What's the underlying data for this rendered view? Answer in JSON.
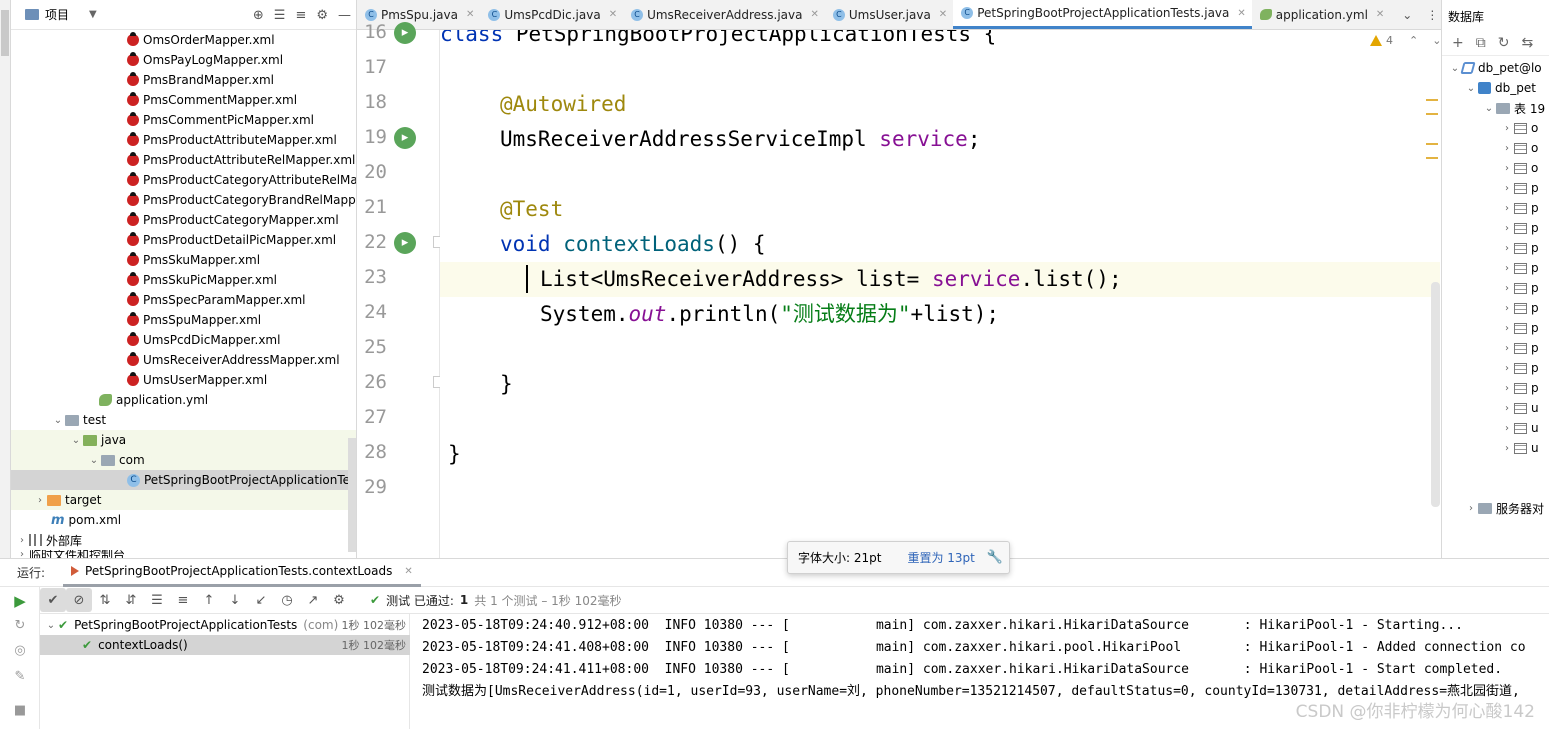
{
  "project": {
    "title": "项目",
    "files": [
      "OmsOrderMapper.xml",
      "OmsPayLogMapper.xml",
      "PmsBrandMapper.xml",
      "PmsCommentMapper.xml",
      "PmsCommentPicMapper.xml",
      "PmsProductAttributeMapper.xml",
      "PmsProductAttributeRelMapper.xml",
      "PmsProductCategoryAttributeRelMap",
      "PmsProductCategoryBrandRelMappe",
      "PmsProductCategoryMapper.xml",
      "PmsProductDetailPicMapper.xml",
      "PmsSkuMapper.xml",
      "PmsSkuPicMapper.xml",
      "PmsSpecParamMapper.xml",
      "PmsSpuMapper.xml",
      "UmsPcdDicMapper.xml",
      "UmsReceiverAddressMapper.xml",
      "UmsUserMapper.xml"
    ],
    "application_yml": "application.yml",
    "test": "test",
    "java": "java",
    "com": "com",
    "test_class": "PetSpringBootProjectApplicationTest",
    "target": "target",
    "pom": "pom.xml",
    "external_libs": "外部库",
    "scratches": "临时文件和控制台"
  },
  "tabs": [
    {
      "label": "PmsSpu.java",
      "icon": "class"
    },
    {
      "label": "UmsPcdDic.java",
      "icon": "class"
    },
    {
      "label": "UmsReceiverAddress.java",
      "icon": "class"
    },
    {
      "label": "UmsUser.java",
      "icon": "class"
    },
    {
      "label": "PetSpringBootProjectApplicationTests.java",
      "icon": "class",
      "active": true
    },
    {
      "label": "application.yml",
      "icon": "yml"
    }
  ],
  "editor": {
    "warnings": "4",
    "line_numbers": [
      "16",
      "17",
      "18",
      "19",
      "20",
      "21",
      "22",
      "23",
      "24",
      "25",
      "26",
      "27",
      "28",
      "29"
    ],
    "code": {
      "l16_kw": "class",
      "l16_name": " PetSpringBootProjectApplicationTests {",
      "l18_ann": "@Autowired",
      "l19_type": "UmsReceiverAddressServiceImpl ",
      "l19_field": "service",
      "l19_end": ";",
      "l21_ann": "@Test",
      "l22_kw": "void",
      "l22_fn": "contextLoads",
      "l22_end": "() {",
      "l23_a": "List<UmsReceiverAddress> list= ",
      "l23_field": "service",
      "l23_b": ".list();",
      "l24_a": "System.",
      "l24_out": "out",
      "l24_b": ".println(",
      "l24_str": "\"测试数据为\"",
      "l24_c": "+list);",
      "l26": "}",
      "l28": "}"
    }
  },
  "font_tip": {
    "size_text": "字体大小: 21pt",
    "reset_text": "重置为 13pt"
  },
  "database": {
    "title": "数据库",
    "connection": "db_pet@lo",
    "schema": "db_pet",
    "tables_folder": "表 19",
    "tables": [
      "o",
      "o",
      "o",
      "p",
      "p",
      "p",
      "p",
      "p",
      "p",
      "p",
      "p",
      "p",
      "p",
      "p",
      "u",
      "u",
      "u"
    ],
    "server_objects": "服务器对"
  },
  "run": {
    "label": "运行:",
    "tab": "PetSpringBootProjectApplicationTests.contextLoads",
    "status_prefix": "测试 已通过:",
    "status_count": "1",
    "status_rest": "共 1 个测试 – 1秒 102毫秒",
    "tests": [
      {
        "name": "PetSpringBootProjectApplicationTests",
        "pkg": "(com)",
        "time": "1秒 102毫秒"
      },
      {
        "name": "contextLoads()",
        "pkg": "",
        "time": "1秒 102毫秒"
      }
    ],
    "console": [
      "2023-05-18T09:24:40.912+08:00  INFO 10380 --- [           main] com.zaxxer.hikari.HikariDataSource       : HikariPool-1 - Starting...",
      "2023-05-18T09:24:41.408+08:00  INFO 10380 --- [           main] com.zaxxer.hikari.pool.HikariPool        : HikariPool-1 - Added connection co",
      "2023-05-18T09:24:41.411+08:00  INFO 10380 --- [           main] com.zaxxer.hikari.HikariDataSource       : HikariPool-1 - Start completed.",
      "测试数据为[UmsReceiverAddress(id=1, userId=93, userName=刘, phoneNumber=13521214507, defaultStatus=0, countyId=130731, detailAddress=燕北园街道,"
    ]
  },
  "watermark": "CSDN @你非柠檬为何心酸142",
  "colors": {
    "keyword": "#0033b3",
    "annotation": "#9e880d",
    "field": "#871094",
    "string": "#067d17",
    "accent": "#4083c9",
    "pass": "#3c9a3c"
  }
}
